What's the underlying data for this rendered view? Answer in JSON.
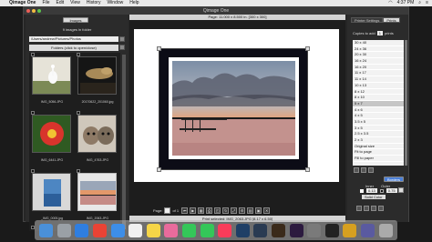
{
  "menubar": {
    "items": [
      "Qimage One",
      "File",
      "Edit",
      "View",
      "History",
      "Window",
      "Help"
    ],
    "time": "4:37 PM"
  },
  "window": {
    "title": "Qimage One"
  },
  "left": {
    "images_button": "Images",
    "count_text": "9 images in folder",
    "path": "/Users/andrew/Pictures/Photos",
    "folders_label": "Folders (click to open/close)",
    "thumbs": [
      {
        "caption": "IMG_5056.JPG"
      },
      {
        "caption": "20170622_201060.jpg"
      },
      {
        "caption": "IMG_6441.JPG"
      },
      {
        "caption": "IMG_4763.JPG"
      },
      {
        "caption": "_IMG_0005.jpg"
      },
      {
        "caption": "IMG_2063.JPG"
      }
    ]
  },
  "center": {
    "page_info": "Page: 11.000 x 8.500 in. [300 x 300]",
    "page_label": "Page:",
    "page_of": "of 1",
    "status": "Print selected: IMG_2063.JPG [8.17 x 6.50]"
  },
  "right": {
    "tab_printer": "Printer Settings",
    "tab_prints": "Prints",
    "copies_label": "Copies to add",
    "copies_value": "1",
    "copies_unit": "prints",
    "sizes": [
      "30 x 40",
      "24 x 36",
      "20 x 30",
      "16 x 24",
      "16 x 20",
      "11 x 17",
      "11 x 14",
      "10 x 13",
      "8 x 12",
      "8 x 10",
      "5 x 7",
      "4 x 6",
      "4 x 5",
      "3.5 x 5",
      "3 x 5",
      "2.5 x 3.5",
      "2 x 3",
      "Original size",
      "Fit to page",
      "Fill to paper"
    ],
    "selected_size_index": 10,
    "borders_button": "Borders",
    "inner_label": "Inner",
    "outer_label": "Outer",
    "inner_value": "0.13",
    "outer_value": "0.75",
    "color_label": "Solid Color"
  },
  "dock": [
    "Finder",
    "Launchpad",
    "Safari",
    "Chrome",
    "Mail",
    "Calendar",
    "Notes",
    "Photos",
    "Messages",
    "FaceTime",
    "Music",
    "Photoshop",
    "Lightroom",
    "Bridge",
    "Premiere",
    "Settings",
    "Terminal",
    "Qimage",
    "App",
    "Trash"
  ]
}
